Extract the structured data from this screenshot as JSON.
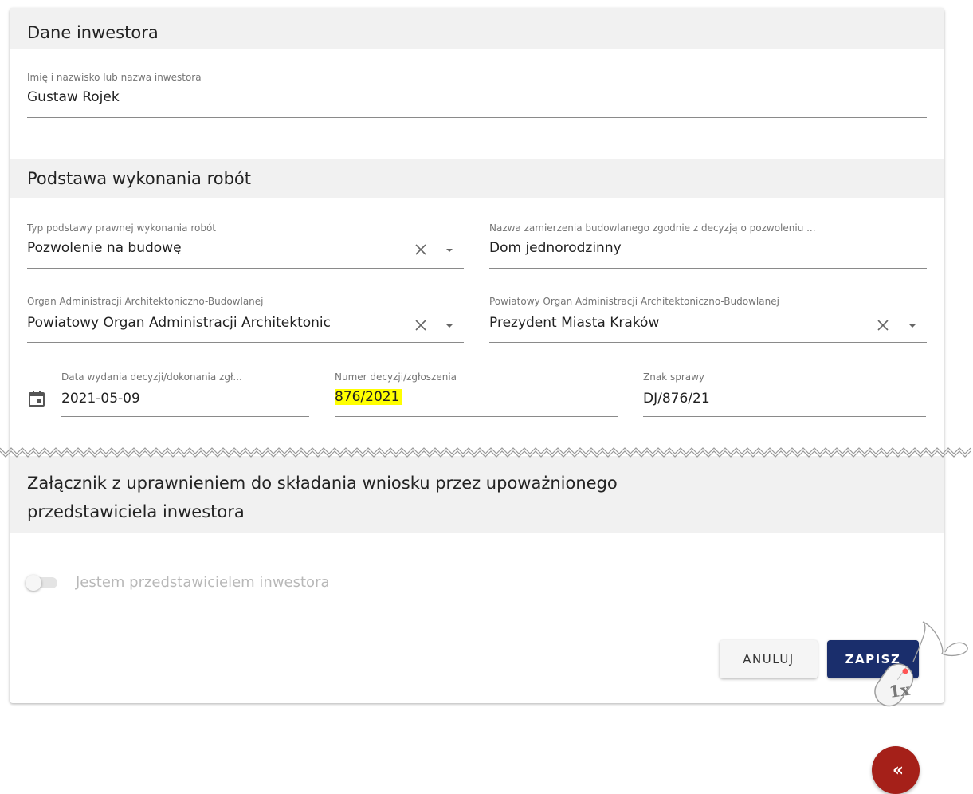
{
  "investor": {
    "section_title": "Dane inwestora",
    "name_label": "Imię i nazwisko lub nazwa inwestora",
    "name_value": "Gustaw Rojek"
  },
  "basis": {
    "section_title": "Podstawa wykonania robót",
    "legal_basis_label": "Typ podstawy prawnej wykonania robót",
    "legal_basis_value": "Pozwolenie na budowę",
    "project_name_label": "Nazwa zamierzenia budowlanego zgodnie z decyzją o pozwoleniu ...",
    "project_name_value": "Dom jednorodzinny",
    "authority_label": "Organ Administracji Architektoniczno-Budowlanej",
    "authority_value": "Powiatowy Organ Administracji Architektonic",
    "district_authority_label": "Powiatowy Organ Administracji Architektoniczno-Budowlanej",
    "district_authority_value": "Prezydent Miasta Kraków",
    "date_label": "Data wydania decyzji/dokonania zgł...",
    "date_value": "2021-05-09",
    "decision_number_label": "Numer decyzji/zgłoszenia",
    "decision_number_value": "876/2021",
    "case_sign_label": "Znak sprawy",
    "case_sign_value": "DJ/876/21"
  },
  "attachment": {
    "section_title_line1": "Załącznik z uprawnieniem do składania wniosku przez upoważnionego",
    "section_title_line2": "przedstawiciela inwestora",
    "toggle_label": "Jestem przedstawicielem inwestora",
    "toggle_on": false
  },
  "actions": {
    "cancel_label": "ANULUJ",
    "save_label": "ZAPISZ"
  },
  "click_indicator": {
    "label": "1x"
  },
  "fab": {
    "label": "«"
  },
  "colors": {
    "primary": "#1a2e6c",
    "fab": "#a52019",
    "highlight": "#ffff00",
    "section_bg": "#f1f1f1"
  },
  "icons": [
    "close-icon",
    "dropdown-arrow-icon",
    "calendar-icon",
    "mouse-icon",
    "double-chevron-left-icon"
  ]
}
